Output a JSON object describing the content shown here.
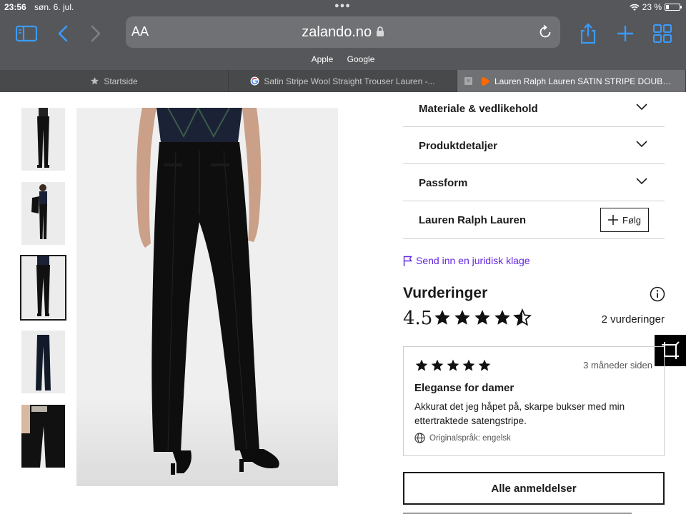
{
  "status_bar": {
    "time": "23:56",
    "date": "søn. 6. jul.",
    "battery": "23 %",
    "battery_level": 0.23
  },
  "browser": {
    "aa_label": "AA",
    "url": "zalando.no",
    "favorites": [
      "Apple",
      "Google"
    ],
    "tabs": [
      {
        "label": "Startside",
        "icon": "star-icon"
      },
      {
        "label": "Satin Stripe Wool Straight Trouser Lauren -...",
        "icon": "google-icon"
      },
      {
        "label": "Lauren Ralph Lauren SATIN STRIPE DOUBLE...",
        "icon": "zalando-icon",
        "active": true
      }
    ]
  },
  "product": {
    "accordion": [
      {
        "label": "Materiale & vedlikehold"
      },
      {
        "label": "Produktdetaljer"
      },
      {
        "label": "Passform"
      }
    ],
    "brand": {
      "label": "Lauren Ralph Lauren",
      "follow": "Følg"
    },
    "legal_link": "Send inn en juridisk klage"
  },
  "ratings": {
    "title": "Vurderinger",
    "score": "4.5",
    "score_value": 4.5,
    "count": "2 vurderinger",
    "review": {
      "stars": 5,
      "ago": "3 måneder siden",
      "title": "Eleganse for damer",
      "body": "Akkurat det jeg håpet på, skarpe bukser med min ettertraktede satengstripe.",
      "language": "Originalspråk: engelsk"
    },
    "all_button": "Alle anmeldelser"
  },
  "colors": {
    "browser_chrome": "#55575a",
    "link_purple": "#6328e0",
    "safari_blue": "#3a9bff",
    "zalando_orange": "#ff6900"
  }
}
